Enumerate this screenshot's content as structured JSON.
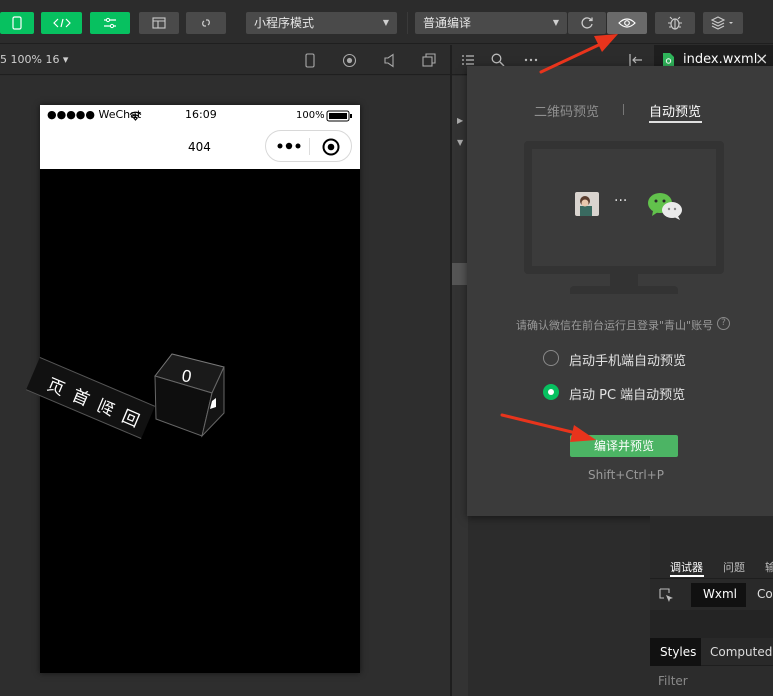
{
  "toolbar": {
    "mode_select": "小程序模式",
    "compile_select": "普通编译"
  },
  "simulator": {
    "zoom_label": "5 100% 16 ▾",
    "status": {
      "signal": "●●●●● WeChat",
      "time": "16:09",
      "battery": "100%"
    },
    "page_title": "404",
    "cube_text": "0",
    "ribbon_text": "回到首页"
  },
  "editor": {
    "file_tab": "index.wxml",
    "close": "×"
  },
  "popover": {
    "tab_qr": "二维码预览",
    "tab_auto": "自动预览",
    "login_hint": "请确认微信在前台运行且登录\"青山\"账号",
    "help": "?",
    "dots": "···",
    "option_mobile": "启动手机端自动预览",
    "option_pc": "启动 PC 端自动预览",
    "compile_button": "编译并预览",
    "shortcut": "Shift+Ctrl+P"
  },
  "devtools": {
    "tabs": [
      "调试器",
      "问题",
      "输"
    ],
    "subtabs": [
      "Wxml",
      "Co"
    ],
    "style_tabs": [
      "Styles",
      "Computed"
    ],
    "filter_placeholder": "Filter"
  },
  "colors": {
    "accent": "#07c160",
    "arrow": "#e8341c",
    "popover_bg": "#3b3b3b"
  }
}
